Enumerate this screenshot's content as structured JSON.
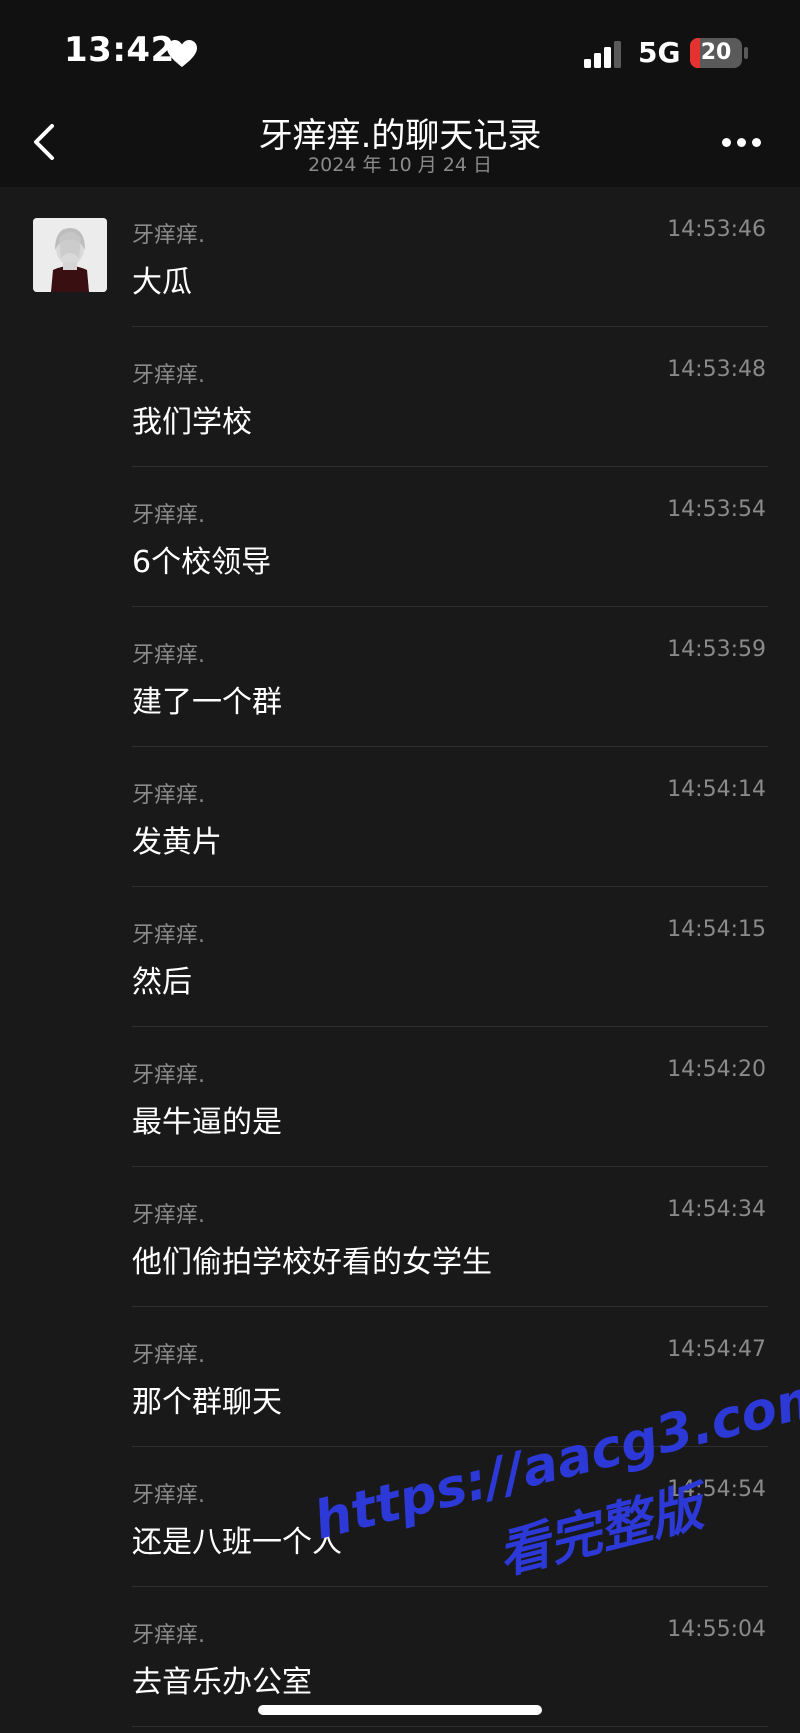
{
  "status_bar": {
    "time": "13:42",
    "network": "5G",
    "battery": "20",
    "battery_level_percent": 20
  },
  "header": {
    "title": "牙痒痒.的聊天记录",
    "date": "2024 年 10 月 24 日"
  },
  "messages": [
    {
      "sender": "牙痒痒.",
      "time": "14:53:46",
      "text": "大瓜"
    },
    {
      "sender": "牙痒痒.",
      "time": "14:53:48",
      "text": "我们学校"
    },
    {
      "sender": "牙痒痒.",
      "time": "14:53:54",
      "text": "6个校领导"
    },
    {
      "sender": "牙痒痒.",
      "time": "14:53:59",
      "text": "建了一个群"
    },
    {
      "sender": "牙痒痒.",
      "time": "14:54:14",
      "text": "发黄片"
    },
    {
      "sender": "牙痒痒.",
      "time": "14:54:15",
      "text": "然后"
    },
    {
      "sender": "牙痒痒.",
      "time": "14:54:20",
      "text": "最牛逼的是"
    },
    {
      "sender": "牙痒痒.",
      "time": "14:54:34",
      "text": "他们偷拍学校好看的女学生"
    },
    {
      "sender": "牙痒痒.",
      "time": "14:54:47",
      "text": "那个群聊天"
    },
    {
      "sender": "牙痒痒.",
      "time": "14:54:54",
      "text": "还是八班一个人"
    },
    {
      "sender": "牙痒痒.",
      "time": "14:55:04",
      "text": "去音乐办公室"
    }
  ],
  "watermark": {
    "url": "https://aacg3.com",
    "caption": "看完整版"
  },
  "icons": {
    "heart": "heart-icon",
    "signal": "signal-icon",
    "back": "back-icon",
    "more": "more-icon"
  },
  "colors": {
    "background": "#191919",
    "bar": "#111111",
    "muted_text": "#8a8a8a",
    "watermark": "#2c39d6",
    "battery_low": "#e5312f"
  }
}
